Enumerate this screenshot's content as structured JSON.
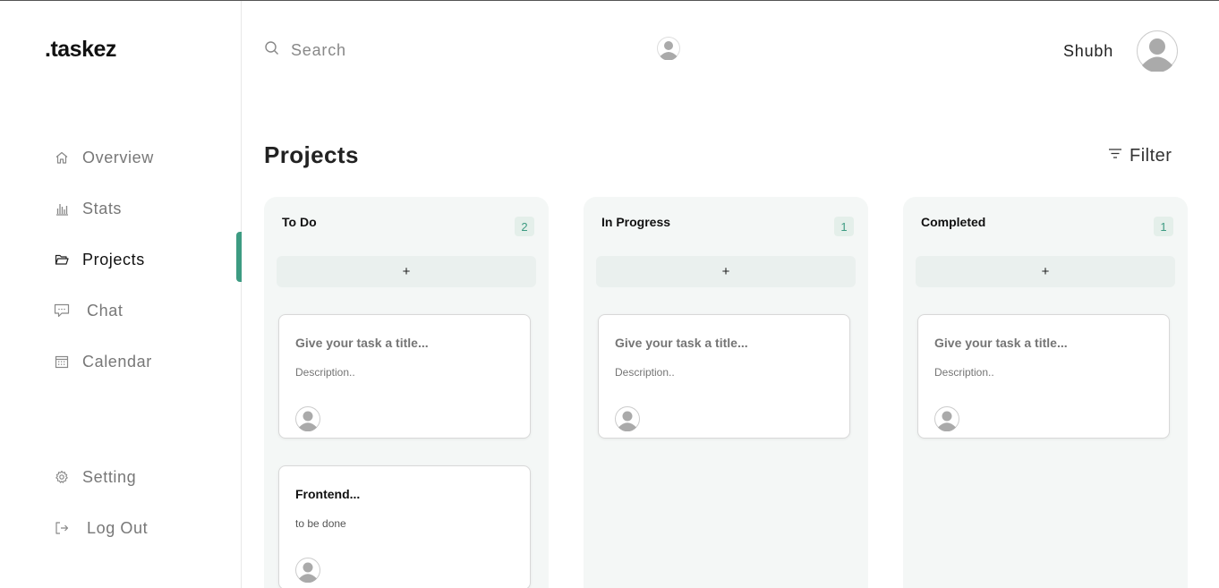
{
  "brand": {
    "logo": ".taskez"
  },
  "sidebar": {
    "items": [
      {
        "label": "Overview",
        "icon": "home-icon"
      },
      {
        "label": "Stats",
        "icon": "stats-icon"
      },
      {
        "label": "Projects",
        "icon": "folder-icon",
        "active": true
      },
      {
        "label": "Chat",
        "icon": "chat-icon"
      },
      {
        "label": "Calendar",
        "icon": "calendar-icon"
      }
    ],
    "bottom": [
      {
        "label": "Setting",
        "icon": "gear-icon"
      },
      {
        "label": "Log Out",
        "icon": "logout-icon"
      }
    ]
  },
  "topbar": {
    "search_placeholder": "Search",
    "user_name": "Shubh"
  },
  "main": {
    "title": "Projects",
    "filter_label": "Filter"
  },
  "columns": [
    {
      "title": "To Do",
      "count": "2",
      "add_label": "+",
      "cards": [
        {
          "title_placeholder": "Give your task a title...",
          "desc_placeholder": "Description.."
        },
        {
          "title": "Frontend...",
          "desc": "to be done"
        }
      ]
    },
    {
      "title": "In Progress",
      "count": "1",
      "add_label": "+",
      "cards": [
        {
          "title_placeholder": "Give your task a title...",
          "desc_placeholder": "Description.."
        }
      ]
    },
    {
      "title": "Completed",
      "count": "1",
      "add_label": "+",
      "cards": [
        {
          "title_placeholder": "Give your task a title...",
          "desc_placeholder": "Description.."
        }
      ]
    }
  ],
  "colors": {
    "accent": "#3d9b82",
    "column_bg": "#f4f7f6",
    "placeholder": "#d4dce6"
  }
}
